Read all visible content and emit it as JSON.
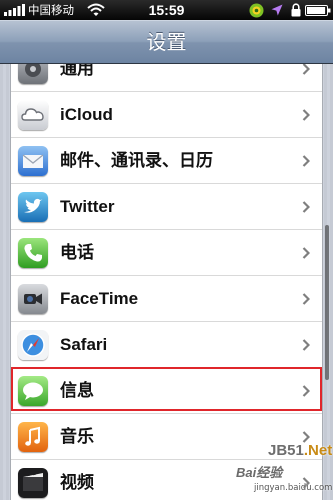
{
  "status_bar": {
    "carrier": "中国移动",
    "time": "15:59",
    "signal_bars": 5,
    "battery_level": 0.95,
    "icons": [
      "signal-icon",
      "wifi-icon",
      "app-notification-icon",
      "location-arrow-icon",
      "rotation-lock-icon",
      "battery-icon"
    ]
  },
  "nav": {
    "title": "设置"
  },
  "settings": {
    "items": [
      {
        "label": "通用",
        "icon": "general-gear-icon"
      },
      {
        "label": "iCloud",
        "icon": "icloud-icon"
      },
      {
        "label": "邮件、通讯录、日历",
        "icon": "mail-icon"
      },
      {
        "label": "Twitter",
        "icon": "twitter-icon"
      },
      {
        "label": "电话",
        "icon": "phone-icon"
      },
      {
        "label": "FaceTime",
        "icon": "facetime-icon"
      },
      {
        "label": "Safari",
        "icon": "safari-icon"
      },
      {
        "label": "信息",
        "icon": "messages-icon",
        "highlighted": true
      },
      {
        "label": "音乐",
        "icon": "music-icon"
      },
      {
        "label": "视频",
        "icon": "videos-icon"
      }
    ]
  },
  "watermark": {
    "site": "JB51",
    "site_tld": ".Net",
    "baidu_text": "Bai",
    "baidu_suffix": "经验",
    "url": "jingyan.baidu.com"
  },
  "colors": {
    "highlight_border": "#e0262b",
    "nav_bar": "#7f93ae",
    "background": "#c7ccd6"
  }
}
